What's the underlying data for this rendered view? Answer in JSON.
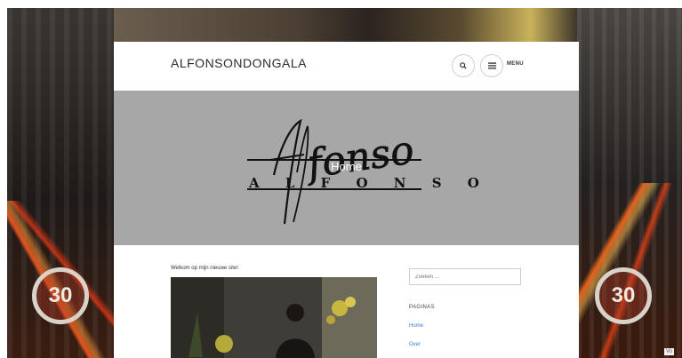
{
  "site": {
    "title": "ALFONSONDONGALA",
    "menu_label": "MENU"
  },
  "hero": {
    "logo_script": "Alfonso",
    "logo_caps": "A L F O N S O",
    "title": "Home"
  },
  "post": {
    "title": "Welkom op mijn nieuwe site!"
  },
  "sidebar": {
    "search_placeholder": "Zoeken …",
    "widget_title": "PAGINAS",
    "links": [
      "Home",
      "Over"
    ]
  },
  "background": {
    "sign_left": "30",
    "sign_right": "30"
  },
  "corner": {
    "label": "Vo"
  },
  "icons": [
    "search-icon",
    "menu-icon"
  ],
  "colors": {
    "hero_bg": "#a7a7a7",
    "link": "#3b7fc4",
    "panel": "#ffffff"
  }
}
